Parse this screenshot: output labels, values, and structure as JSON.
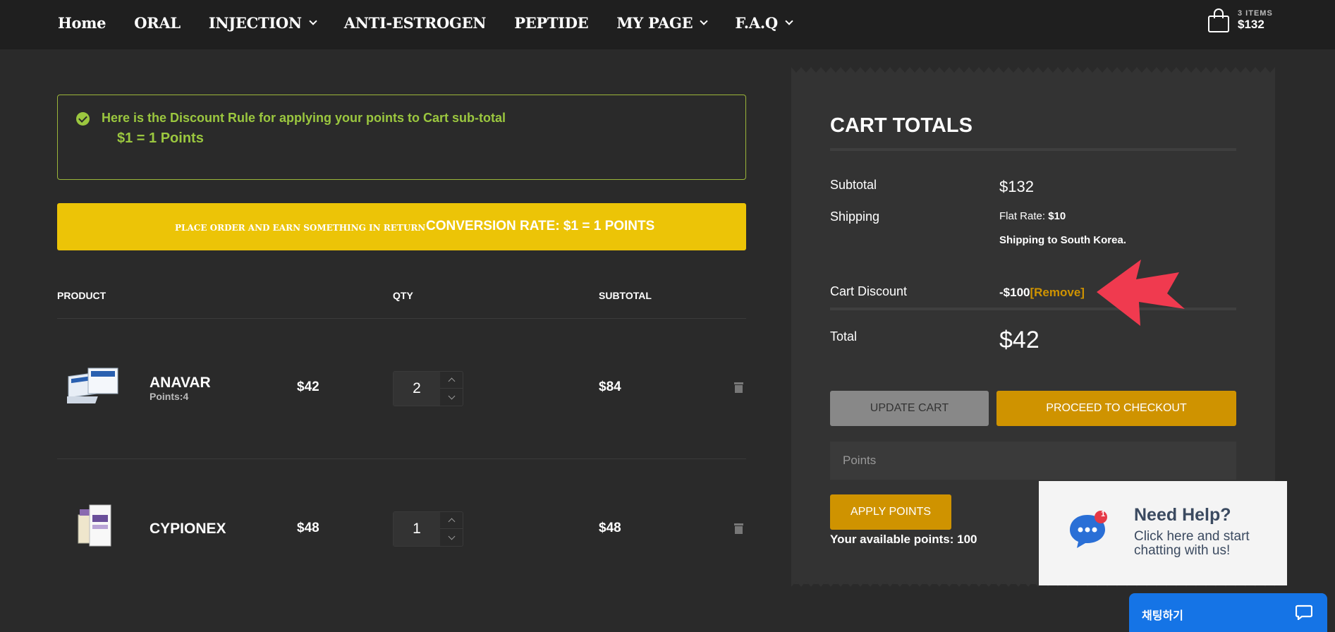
{
  "nav": {
    "items": [
      {
        "label": "Home",
        "dropdown": false
      },
      {
        "label": "ORAL",
        "dropdown": false
      },
      {
        "label": "INJECTION",
        "dropdown": true
      },
      {
        "label": "ANTI-ESTROGEN",
        "dropdown": false
      },
      {
        "label": "PEPTIDE",
        "dropdown": false
      },
      {
        "label": "MY PAGE",
        "dropdown": true
      },
      {
        "label": "F.A.Q",
        "dropdown": true
      }
    ],
    "cart_items": "3 ITEMS",
    "cart_amount": "$132"
  },
  "notice": {
    "line1": "Here is the Discount Rule for applying your points to Cart sub-total",
    "line2": "$1 = 1 Points"
  },
  "banner": {
    "small": "PLACE ORDER AND EARN SOMETHING IN RETURN",
    "big": "CONVERSION RATE: $1 = 1 POINTS",
    "color": "#ecc407"
  },
  "table": {
    "headers": {
      "product": "PRODUCT",
      "qty": "QTY",
      "subtotal": "SUBTOTAL"
    },
    "rows": [
      {
        "name": "ANAVAR",
        "points": "Points:4",
        "price": "$42",
        "qty": "2",
        "subtotal": "$84"
      },
      {
        "name": "CYPIONEX",
        "points": "",
        "price": "$48",
        "qty": "1",
        "subtotal": "$48"
      }
    ]
  },
  "totals": {
    "title": "CART TOTALS",
    "subtotal_label": "Subtotal",
    "subtotal_value": "$132",
    "shipping_label": "Shipping",
    "shipping_rate_label": "Flat Rate:",
    "shipping_rate_value": "$10",
    "shipping_to": "Shipping to South Korea.",
    "discount_label": "Cart Discount",
    "discount_value": "-$100",
    "remove_link": "[Remove]",
    "total_label": "Total",
    "total_value": "$42",
    "update_button": "UPDATE CART",
    "checkout_button": "PROCEED TO CHECKOUT",
    "points_placeholder": "Points",
    "apply_button": "APPLY POINTS",
    "available_points": "Your available points: 100",
    "accent_color": "#cf9300"
  },
  "help_widget": {
    "badge": "1",
    "title": "Need Help?",
    "line1": "Click here and start",
    "line2": "chatting with us!"
  },
  "chat_bar": {
    "label": "채팅하기",
    "color": "#1574e6"
  },
  "icons": [
    "check-circle-icon",
    "shopping-bag-icon",
    "chevron-down-icon",
    "trash-icon",
    "chat-bubble-icon",
    "chat-icon"
  ]
}
